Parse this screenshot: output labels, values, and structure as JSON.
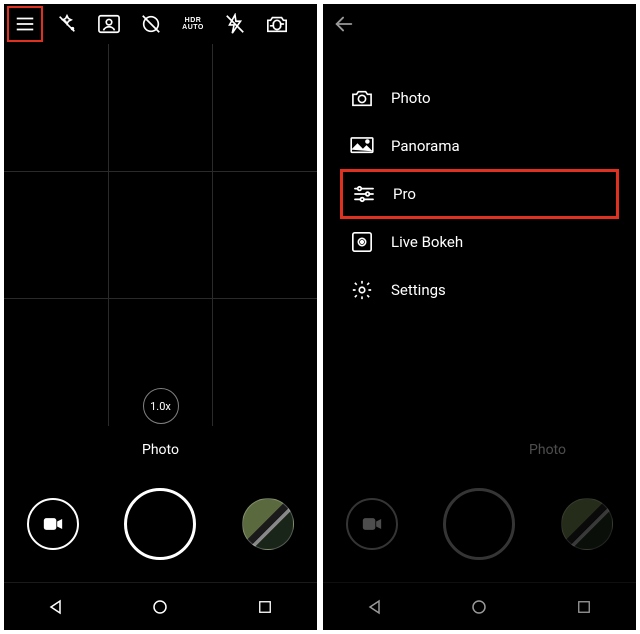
{
  "left": {
    "topbar": {
      "icons": [
        "menu",
        "magic-off",
        "portrait",
        "filter-off",
        "hdr-auto",
        "flash-off",
        "switch-camera"
      ]
    },
    "zoom_label": "1.0x",
    "mode_label": "Photo",
    "controls": {
      "video": "video",
      "shutter": "shutter",
      "gallery": "gallery-thumb"
    },
    "nav": [
      "back",
      "home",
      "recent"
    ]
  },
  "right": {
    "back_icon": "back-arrow",
    "menu": [
      {
        "icon": "camera-icon",
        "label": "Photo",
        "highlight": false
      },
      {
        "icon": "panorama-icon",
        "label": "Panorama",
        "highlight": false
      },
      {
        "icon": "sliders-icon",
        "label": "Pro",
        "highlight": true
      },
      {
        "icon": "bokeh-icon",
        "label": "Live Bokeh",
        "highlight": false
      },
      {
        "icon": "settings-icon",
        "label": "Settings",
        "highlight": false
      }
    ],
    "mode_label": "Photo",
    "nav": [
      "back",
      "home",
      "recent"
    ]
  },
  "hdr": {
    "line1": "HDR",
    "line2": "AUTO"
  }
}
